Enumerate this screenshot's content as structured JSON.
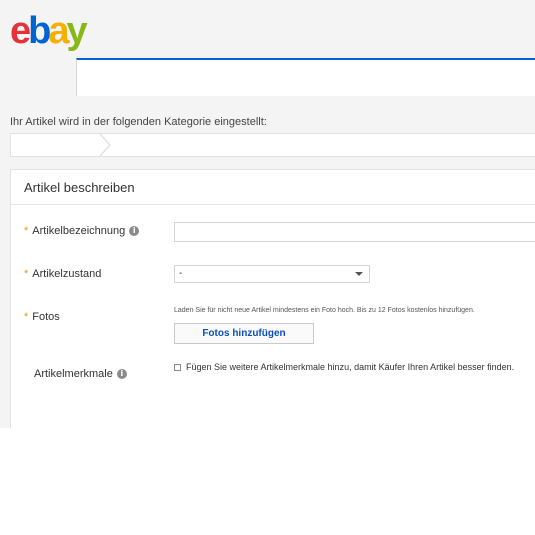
{
  "header": {
    "logo_letters": [
      {
        "char": "e",
        "color": "#e53238"
      },
      {
        "char": "b",
        "color": "#0064d2"
      },
      {
        "char": "a",
        "color": "#f5af02"
      },
      {
        "char": "y",
        "color": "#86b817"
      }
    ],
    "search": {
      "value": "",
      "placeholder": ""
    }
  },
  "category": {
    "intro": "Ihr Artikel wird in der folgenden Kategorie eingestellt:",
    "breadcrumb": ""
  },
  "form": {
    "title": "Artikel beschreiben",
    "title_field": {
      "label": "Artikelbezeichnung",
      "value": ""
    },
    "condition_field": {
      "label": "Artikelzustand",
      "selected": "-"
    },
    "photos_field": {
      "label": "Fotos",
      "hint": "Laden Sie für nicht neue Artikel mindestens ein Foto hoch. Bis zu 12 Fotos kostenlos hinzufügen.",
      "button": "Fotos hinzufügen"
    },
    "specifics_field": {
      "label": "Artikelmerkmale",
      "checkbox_label": "Fügen Sie weitere Artikelmerkmale hinzu, damit Käufer Ihren Artikel besser finden.",
      "checked": false
    },
    "required_marker": "*",
    "info_glyph": "i"
  },
  "colors": {
    "accent": "#0a63d6",
    "required": "#e49b0f"
  }
}
